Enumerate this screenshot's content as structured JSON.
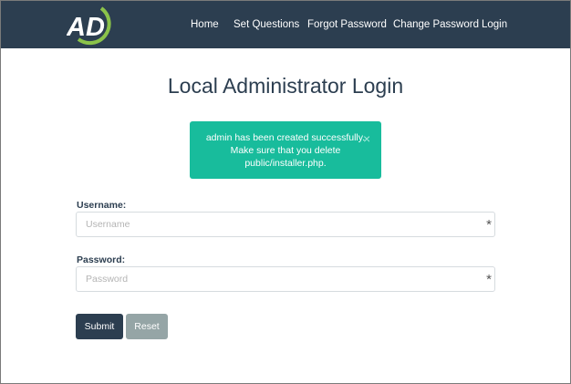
{
  "nav": {
    "logo_text": "AD",
    "items": [
      "Home",
      "Set Questions",
      "Forgot Password",
      "Change Password",
      "Login"
    ]
  },
  "page": {
    "title": "Local Administrator Login"
  },
  "alert": {
    "lines": [
      "admin has been created successfully.",
      "Make sure that you delete",
      "public/installer.php."
    ],
    "close_symbol": "×",
    "color": "#18bc9c"
  },
  "form": {
    "username_label": "Username:",
    "username_placeholder": "Username",
    "username_value": "",
    "password_label": "Password:",
    "password_placeholder": "Password",
    "password_value": "",
    "required_marker": "*",
    "submit_label": "Submit",
    "reset_label": "Reset"
  },
  "colors": {
    "navbar": "#2c3e50",
    "primary": "#2c3e50",
    "success": "#18bc9c",
    "secondary": "#95a5a6",
    "logo_accent": "#8bc34a"
  }
}
